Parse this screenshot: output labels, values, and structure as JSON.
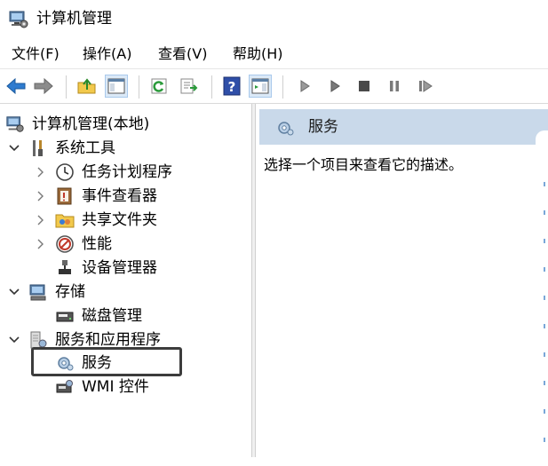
{
  "window": {
    "title": "计算机管理"
  },
  "menu": [
    {
      "label": "文件(F)"
    },
    {
      "label": "操作(A)"
    },
    {
      "label": "查看(V)"
    },
    {
      "label": "帮助(H)"
    }
  ],
  "toolbar": {
    "buttons": [
      {
        "icon": "back-arrow-icon"
      },
      {
        "icon": "forward-arrow-icon"
      },
      {
        "icon": "up-folder-icon"
      },
      {
        "icon": "show-hide-console-tree-icon"
      },
      {
        "icon": "refresh-icon"
      },
      {
        "icon": "export-list-icon"
      },
      {
        "icon": "help-icon"
      },
      {
        "icon": "show-action-pane-icon"
      },
      {
        "icon": "start-service-icon"
      },
      {
        "icon": "start-service-alt-icon"
      },
      {
        "icon": "stop-service-icon"
      },
      {
        "icon": "pause-service-icon"
      },
      {
        "icon": "restart-service-icon"
      }
    ]
  },
  "tree": {
    "root": {
      "label": "计算机管理(本地)"
    },
    "items": [
      {
        "label": "系统工具",
        "icon": "tools-icon",
        "expanded": true
      },
      {
        "label": "任务计划程序",
        "icon": "clock-icon",
        "collapsed": true
      },
      {
        "label": "事件查看器",
        "icon": "event-viewer-icon",
        "collapsed": true
      },
      {
        "label": "共享文件夹",
        "icon": "shared-folder-icon",
        "collapsed": true
      },
      {
        "label": "性能",
        "icon": "performance-icon",
        "collapsed": true
      },
      {
        "label": "设备管理器",
        "icon": "device-manager-icon"
      },
      {
        "label": "存储",
        "icon": "storage-icon",
        "expanded": true
      },
      {
        "label": "磁盘管理",
        "icon": "disk-icon"
      },
      {
        "label": "服务和应用程序",
        "icon": "services-apps-icon",
        "expanded": true
      },
      {
        "label": "服务",
        "icon": "gear-icon",
        "selected": true
      },
      {
        "label": "WMI 控件",
        "icon": "wmi-icon"
      }
    ]
  },
  "content": {
    "header": "服务",
    "description": "选择一个项目来查看它的描述。"
  },
  "colors": {
    "header_bg": "#c9d9ea",
    "accent_blue": "#2e7bcf",
    "highlight_border": "#3c3c3c"
  }
}
